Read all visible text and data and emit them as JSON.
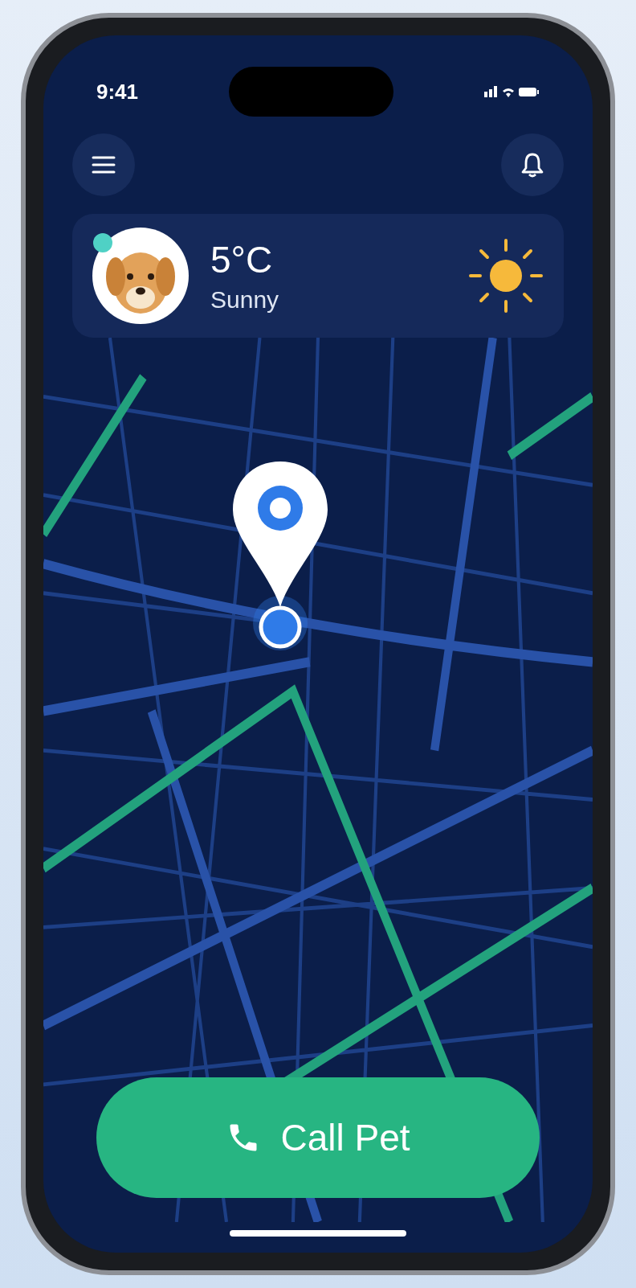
{
  "status_bar": {
    "time": "9:41"
  },
  "weather": {
    "temperature": "5°C",
    "condition": "Sunny"
  },
  "call_button": {
    "label": "Call Pet"
  }
}
